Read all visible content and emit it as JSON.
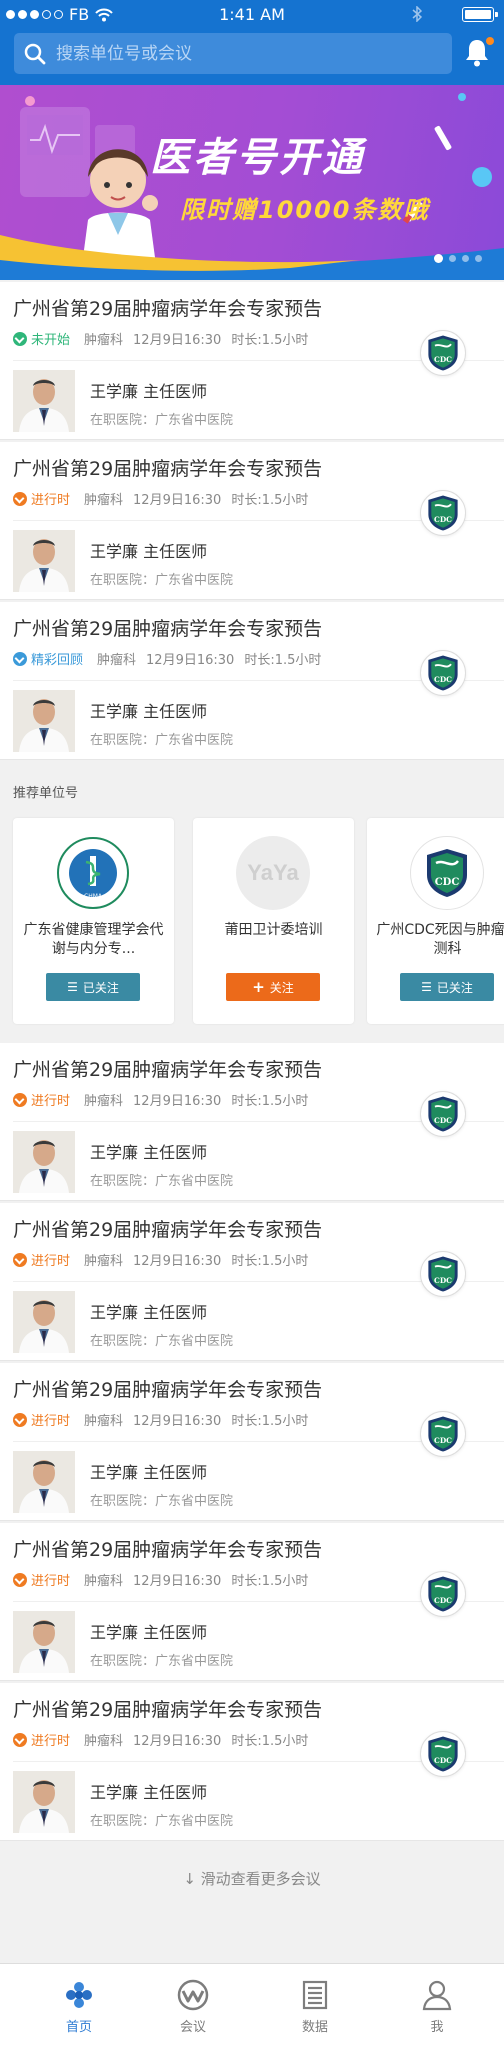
{
  "status_bar": {
    "carrier": "FB",
    "time": "1:41 AM"
  },
  "search": {
    "placeholder": "搜索单位号或会议"
  },
  "banner": {
    "title": "医者号开通",
    "subtitle": "限时赠10000条数哦",
    "page_count": 4,
    "active_page": 1
  },
  "colors": {
    "primary": "#1573d0",
    "status_upcoming": "#2fb67a",
    "status_live": "#ef7b22",
    "status_replay": "#3b9ad9",
    "follow_button": "#3a8aa3",
    "follow_add_button": "#ec6a1a"
  },
  "conferences": [
    {
      "title": "广州省第29届肿瘤病学年会专家预告",
      "status": "未开始",
      "status_type": "upcoming",
      "dept": "肿瘤科",
      "time": "12月9日16:30",
      "duration": "时长:1.5小时",
      "doctor": "王学廉  主任医师",
      "hospital": "在职医院：广东省中医院",
      "logo_text": "CDC"
    },
    {
      "title": "广州省第29届肿瘤病学年会专家预告",
      "status": "进行时",
      "status_type": "live",
      "dept": "肿瘤科",
      "time": "12月9日16:30",
      "duration": "时长:1.5小时",
      "doctor": "王学廉  主任医师",
      "hospital": "在职医院：广东省中医院",
      "logo_text": "CDC"
    },
    {
      "title": "广州省第29届肿瘤病学年会专家预告",
      "status": "精彩回顾",
      "status_type": "replay",
      "dept": "肿瘤科",
      "time": "12月9日16:30",
      "duration": "时长:1.5小时",
      "doctor": "王学廉  主任医师",
      "hospital": "在职医院：广东省中医院",
      "logo_text": "CDC"
    },
    {
      "title": "广州省第29届肿瘤病学年会专家预告",
      "status": "进行时",
      "status_type": "live",
      "dept": "肿瘤科",
      "time": "12月9日16:30",
      "duration": "时长:1.5小时",
      "doctor": "王学廉  主任医师",
      "hospital": "在职医院：广东省中医院",
      "logo_text": "CDC"
    },
    {
      "title": "广州省第29届肿瘤病学年会专家预告",
      "status": "进行时",
      "status_type": "live",
      "dept": "肿瘤科",
      "time": "12月9日16:30",
      "duration": "时长:1.5小时",
      "doctor": "王学廉  主任医师",
      "hospital": "在职医院：广东省中医院",
      "logo_text": "CDC"
    },
    {
      "title": "广州省第29届肿瘤病学年会专家预告",
      "status": "进行时",
      "status_type": "live",
      "dept": "肿瘤科",
      "time": "12月9日16:30",
      "duration": "时长:1.5小时",
      "doctor": "王学廉  主任医师",
      "hospital": "在职医院：广东省中医院",
      "logo_text": "CDC"
    },
    {
      "title": "广州省第29届肿瘤病学年会专家预告",
      "status": "进行时",
      "status_type": "live",
      "dept": "肿瘤科",
      "time": "12月9日16:30",
      "duration": "时长:1.5小时",
      "doctor": "王学廉  主任医师",
      "hospital": "在职医院：广东省中医院",
      "logo_text": "CDC"
    },
    {
      "title": "广州省第29届肿瘤病学年会专家预告",
      "status": "进行时",
      "status_type": "live",
      "dept": "肿瘤科",
      "time": "12月9日16:30",
      "duration": "时长:1.5小时",
      "doctor": "王学廉  主任医师",
      "hospital": "在职医院：广东省中医院",
      "logo_text": "CDC"
    }
  ],
  "recommended": {
    "title": "推荐单位号",
    "units": [
      {
        "name": "广东省健康管理学会代谢与内分专...",
        "button": "已关注",
        "button_type": "followed",
        "logo_text": "CHMA"
      },
      {
        "name": "莆田卫计委培训",
        "button": "关注",
        "button_type": "follow",
        "logo_text": "YaYa"
      },
      {
        "name": "广州CDC死因与肿瘤监测科",
        "button": "已关注",
        "button_type": "followed",
        "logo_text": "CDC"
      }
    ]
  },
  "load_more": "↓ 滑动查看更多会议",
  "tabs": [
    {
      "label": "首页",
      "icon": "home-icon",
      "active": true
    },
    {
      "label": "会议",
      "icon": "meeting-icon",
      "active": false
    },
    {
      "label": "数据",
      "icon": "data-icon",
      "active": false
    },
    {
      "label": "我",
      "icon": "profile-icon",
      "active": false
    }
  ]
}
